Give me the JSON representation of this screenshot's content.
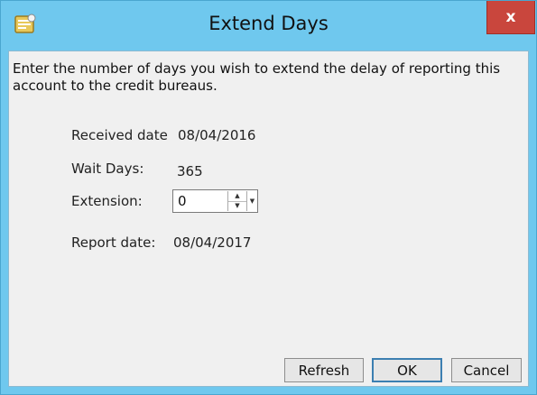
{
  "window": {
    "title": "Extend Days",
    "close_label": "x",
    "app_icon": "app-icon",
    "colors": {
      "frame": "#6fc8ee",
      "close": "#c9463d",
      "client": "#f0f0f0"
    }
  },
  "dialog": {
    "instructions": "Enter the number of days you wish to extend the delay of reporting this account to the credit bureaus.",
    "fields": {
      "received_label": "Received date",
      "received_value": "08/04/2016",
      "wait_label": "Wait Days:",
      "wait_value": "365",
      "extension_label": "Extension:",
      "extension_value": "0",
      "report_label": "Report date:",
      "report_value": "08/04/2017"
    },
    "buttons": {
      "refresh": "Refresh",
      "ok": "OK",
      "cancel": "Cancel"
    }
  }
}
